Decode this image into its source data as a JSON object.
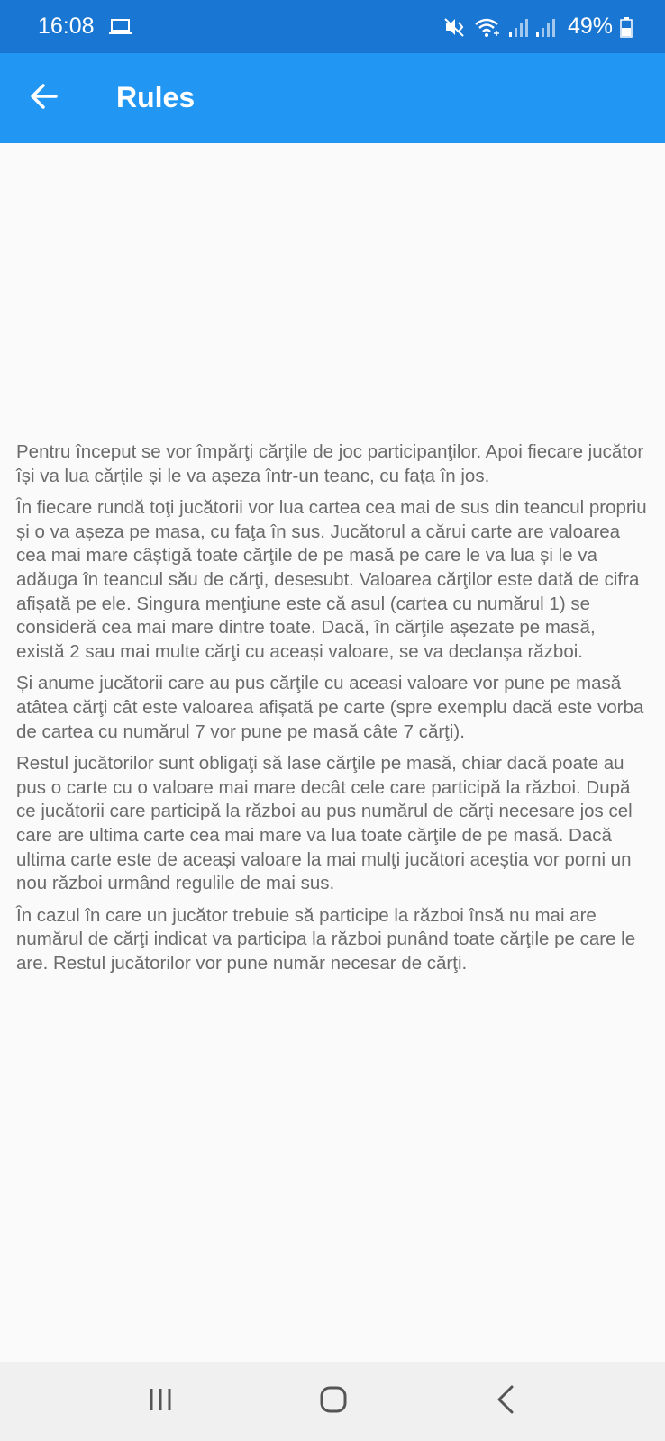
{
  "status_bar": {
    "time": "16:08",
    "battery": "49%",
    "icons": [
      "laptop-icon",
      "mute-vibrate-icon",
      "wifi-icon",
      "signal-icon",
      "signal-icon-2",
      "battery-icon"
    ]
  },
  "app_bar": {
    "title": "Rules",
    "back_icon": "arrow-back-icon",
    "color": "#2196f3"
  },
  "rules": {
    "paragraphs": [
      "Pentru început se vor împărţi cărţile de joc participanţilor. Apoi fiecare jucător își va lua cărţile și le va așeza într-un teanc, cu faţa în jos.",
      "În fiecare rundă toţi jucătorii vor lua cartea cea mai de sus din teancul propriu și o va așeza pe masa, cu faţa în sus. Jucătorul a cărui carte are valoarea cea mai mare câștigă toate cărţile de pe masă pe care le va lua și le va adăuga în teancul său de cărţi, desesubt. Valoarea cărţilor este dată de cifra afișată pe ele. Singura menţiune este că asul (cartea cu numărul 1) se consideră cea mai mare dintre toate. Dacă, în cărţile așezate pe masă, există 2 sau mai multe cărţi cu aceași valoare, se va declanșa război.",
      "Și anume jucătorii care au pus cărţile cu aceasi valoare vor pune pe masă atâtea cărţi cât este valoarea afișată pe carte (spre exemplu dacă este vorba de cartea cu numărul 7 vor pune pe masă câte 7 cărţi).",
      "Restul jucătorilor sunt obligaţi să lase cărţile pe masă, chiar dacă poate au pus o carte cu o valoare mai mare decât cele care participă la război. După ce jucătorii care participă la război au pus numărul de cărţi necesare jos cel care are ultima carte cea mai mare va lua toate cărţile de pe masă. Dacă ultima carte este de aceași valoare la mai mulţi jucători aceștia vor porni un nou război urmând regulile de mai sus.",
      "În cazul în care un jucător trebuie să participe la război însă nu mai are numărul de cărţi indicat va participa la război punând toate cărţile pe care le are. Restul jucătorilor vor pune număr necesar de cărţi."
    ]
  },
  "nav_bar": {
    "buttons": [
      "recent-apps-icon",
      "home-icon",
      "nav-back-icon"
    ]
  }
}
